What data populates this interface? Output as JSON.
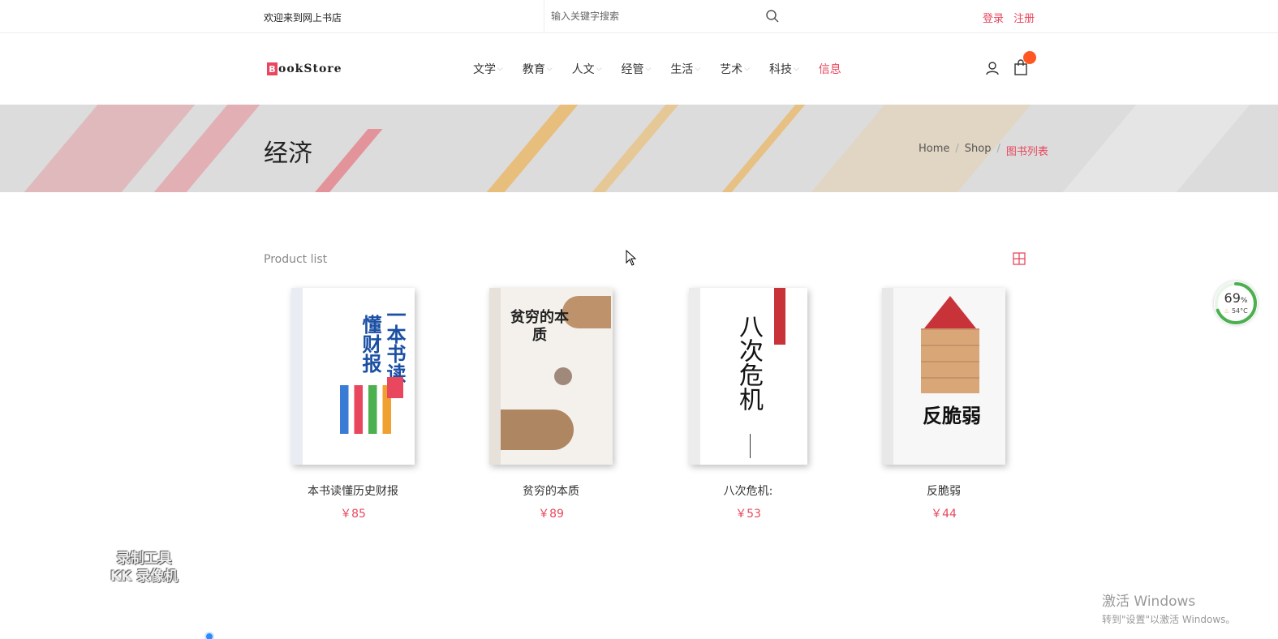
{
  "topbar": {
    "welcome": "欢迎来到网上书店",
    "search_placeholder": "输入关键字搜索",
    "login": "登录",
    "register": "注册"
  },
  "header": {
    "logo_letter": "B",
    "logo_text": "ookStore",
    "nav": [
      {
        "label": "文学"
      },
      {
        "label": "教育"
      },
      {
        "label": "人文"
      },
      {
        "label": "经管"
      },
      {
        "label": "生活"
      },
      {
        "label": "艺术"
      },
      {
        "label": "科技"
      },
      {
        "label": "信息"
      }
    ]
  },
  "banner": {
    "title": "经济",
    "breadcrumb": [
      "Home",
      "Shop",
      "图书列表"
    ]
  },
  "products": {
    "heading": "Product list",
    "items": [
      {
        "name": "本书读懂历史财报",
        "price": "￥85",
        "cover_title": "一本书读懂财报"
      },
      {
        "name": "贫穷的本质",
        "price": "￥89",
        "cover_title": "贫穷的本质"
      },
      {
        "name": "八次危机:",
        "price": "￥53",
        "cover_title": "八次危机"
      },
      {
        "name": "反脆弱",
        "price": "￥44",
        "cover_title": "反脆弱"
      }
    ]
  },
  "widget": {
    "percent": "69",
    "percent_unit": "%",
    "temp": "54°C"
  },
  "overlay": {
    "watermark_line1": "录制工具",
    "watermark_line2": "KK 录像机",
    "activate_line1": "激活 Windows",
    "activate_line2": "转到\"设置\"以激活 Windows。"
  },
  "colors": {
    "accent": "#e8475d",
    "badge": "#ff5722"
  }
}
